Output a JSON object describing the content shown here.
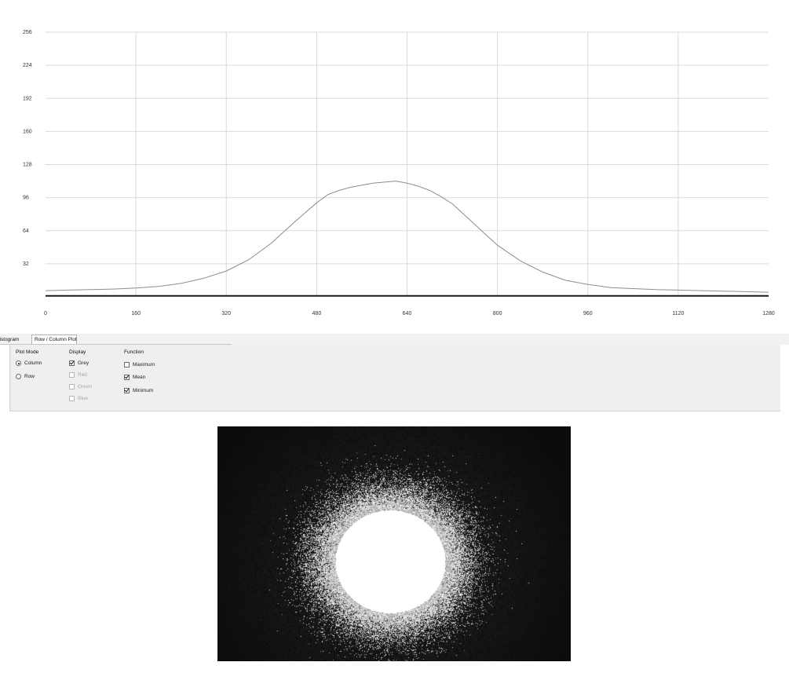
{
  "chart_data": {
    "type": "line",
    "title": "",
    "xlabel": "",
    "ylabel": "",
    "xlim": [
      0,
      1280
    ],
    "ylim": [
      0,
      256
    ],
    "x_ticks": [
      0,
      160,
      320,
      480,
      640,
      800,
      960,
      1120,
      1280
    ],
    "y_ticks": [
      32,
      64,
      96,
      128,
      160,
      192,
      224,
      256
    ],
    "x_tick_labels": [
      "0",
      "160",
      "320",
      "480",
      "640",
      "800",
      "960",
      "1120",
      "1280"
    ],
    "y_tick_labels": [
      "32",
      "64",
      "96",
      "128",
      "160",
      "192",
      "224",
      "256"
    ],
    "grid": true,
    "series": [
      {
        "color": "#8c8c8c",
        "x": [
          0,
          40,
          80,
          120,
          160,
          200,
          240,
          280,
          320,
          360,
          400,
          440,
          480,
          500,
          520,
          540,
          560,
          580,
          600,
          620,
          640,
          660,
          680,
          700,
          720,
          760,
          800,
          840,
          880,
          920,
          960,
          1000,
          1040,
          1080,
          1120,
          1160,
          1200,
          1240,
          1280
        ],
        "y": [
          6,
          6.5,
          7,
          7.5,
          8.5,
          10,
          13,
          18,
          25,
          36,
          52,
          72,
          91,
          99,
          103,
          106,
          108,
          110,
          111,
          112,
          110,
          107,
          103,
          97,
          90,
          70,
          50,
          35,
          24,
          16,
          12,
          9,
          8,
          7,
          6.5,
          6,
          5.5,
          5,
          4.5
        ]
      },
      {
        "color": "#1a1a1a",
        "x": [
          0,
          1280
        ],
        "y": [
          1,
          1
        ]
      }
    ]
  },
  "tabs": {
    "histogram": "listogram",
    "row_column": "Row / Column Plot"
  },
  "controls": {
    "plot_mode": {
      "title": "Plot Mode",
      "column": "Column",
      "row": "Row",
      "selected": "Column"
    },
    "display": {
      "title": "Display",
      "grey": "Grey",
      "red": "Red",
      "green": "Green",
      "blue": "Blue"
    },
    "function": {
      "title": "Function",
      "maximum": "Maximum",
      "mean": "Mean",
      "minimum": "Minimum"
    }
  },
  "beam_image": {
    "background": "#0b0b0b",
    "core_color": "#ffffff"
  }
}
